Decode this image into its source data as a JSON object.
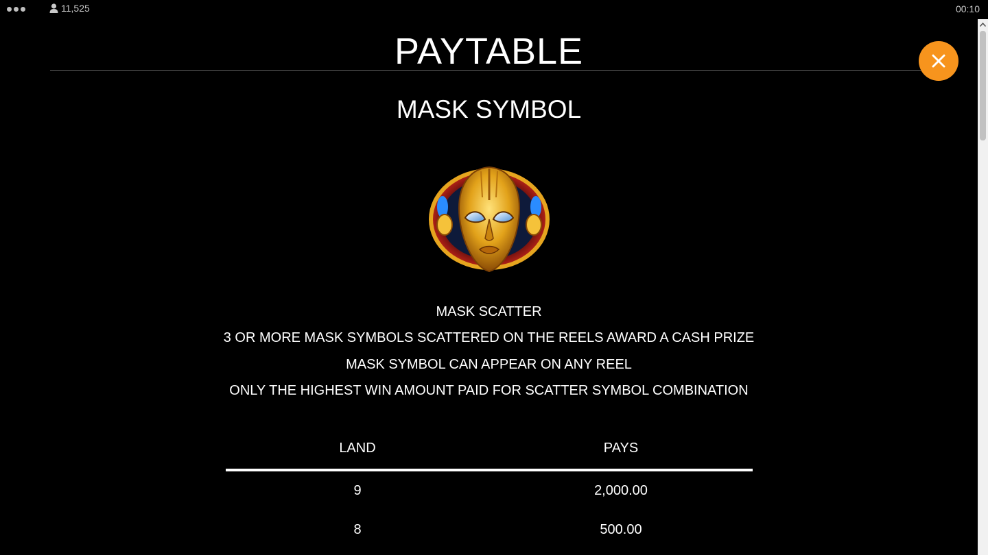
{
  "status_bar": {
    "player_count": "11,525",
    "clock": "00:10"
  },
  "title": "PAYTABLE",
  "section_title": "MASK SYMBOL",
  "descriptions": [
    "MASK SCATTER",
    "3 OR MORE MASK SYMBOLS SCATTERED ON THE REELS AWARD A CASH PRIZE",
    "MASK SYMBOL CAN APPEAR ON ANY REEL",
    "ONLY THE HIGHEST WIN AMOUNT PAID FOR SCATTER SYMBOL COMBINATION"
  ],
  "pay_table": {
    "headers": [
      "LAND",
      "PAYS"
    ],
    "rows": [
      [
        "9",
        "2,000.00"
      ],
      [
        "8",
        "500.00"
      ]
    ]
  },
  "colors": {
    "background": "#000000",
    "close_button": "#f7941d",
    "text": "#ffffff"
  },
  "icons": {
    "menu": "menu-dots-icon",
    "player": "user-icon",
    "close": "close-icon",
    "symbol": "mask-symbol-icon"
  }
}
